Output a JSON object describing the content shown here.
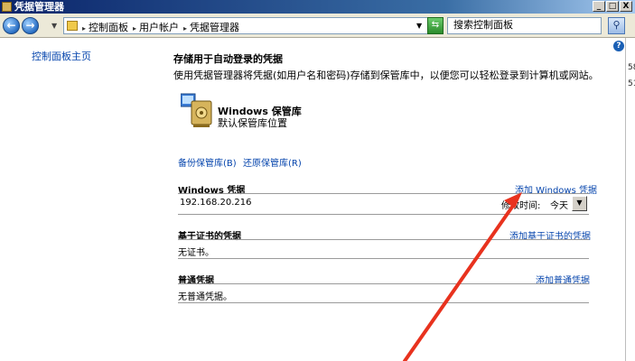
{
  "window": {
    "title": "凭据管理器",
    "controls": [
      "_",
      "□",
      "X"
    ]
  },
  "address_bar": {
    "breadcrumbs": [
      "控制面板",
      "用户帐户",
      "凭据管理器"
    ],
    "search_placeholder": "搜索控制面板"
  },
  "sidebar": {
    "home_link": "控制面板主页"
  },
  "main": {
    "heading": "存储用于自动登录的凭据",
    "description": "使用凭据管理器将凭据(如用户名和密码)存储到保管库中，以便您可以轻松登录到计算机或网站。",
    "vault": {
      "title": "Windows 保管库",
      "subtitle": "默认保管库位置"
    },
    "backup_link": "备份保管库(B)",
    "restore_link": "还原保管库(R)",
    "windows_credentials": {
      "title": "Windows 凭据",
      "add_link": "添加 Windows 凭据",
      "entry": "192.168.20.216",
      "modified_label": "修改时间:",
      "modified_value": "今天"
    },
    "certificate_credentials": {
      "title": "基于证书的凭据",
      "add_link": "添加基于证书的凭据",
      "empty": "无证书。"
    },
    "generic_credentials": {
      "title": "普通凭据",
      "add_link": "添加普通凭据",
      "empty": "无普通凭据。"
    }
  },
  "right_edge_fragments": [
    "58",
    "51"
  ],
  "annotation_color": "#e8321e"
}
